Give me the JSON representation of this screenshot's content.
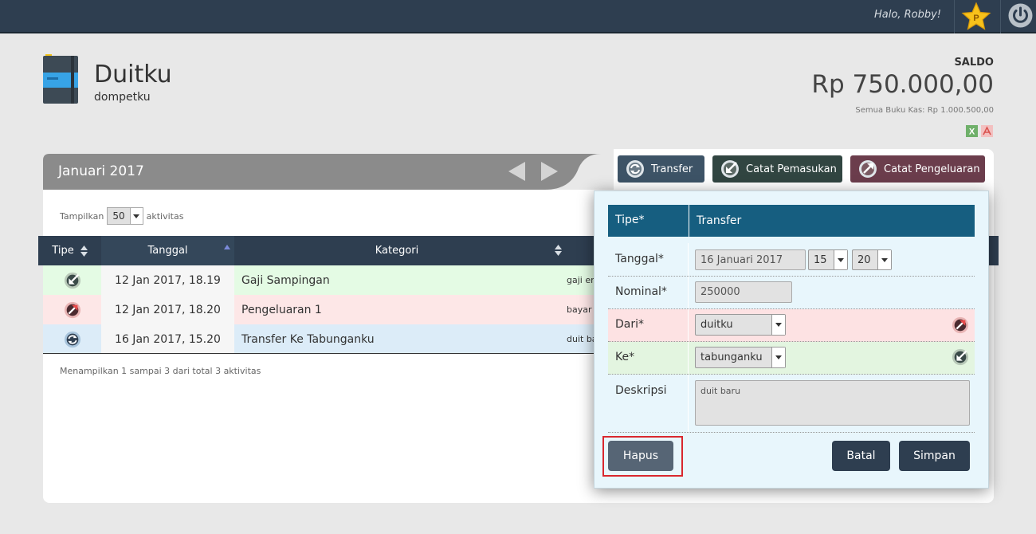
{
  "topbar": {
    "greeting": "Halo, Robby!",
    "star_letter": "P"
  },
  "wallet": {
    "title": "Duitku",
    "subtitle": "dompetku"
  },
  "balance": {
    "label": "SALDO",
    "value": "Rp 750.000,00",
    "all_books": "Semua Buku Kas: Rp 1.000.500,00"
  },
  "period": {
    "month": "Januari 2017"
  },
  "actions": {
    "transfer": "Transfer",
    "income": "Catat Pemasukan",
    "expense": "Catat Pengeluaran"
  },
  "list": {
    "show_prefix": "Tampilkan",
    "page_size": "50",
    "show_suffix": "aktivitas",
    "headers": {
      "type": "Tipe",
      "date": "Tanggal",
      "category": "Kategori"
    },
    "rows": [
      {
        "kind": "income",
        "date": "12 Jan 2017, 18.19",
        "category": "Gaji Sampingan",
        "desc": "gaji en"
      },
      {
        "kind": "expense",
        "date": "12 Jan 2017, 18.20",
        "category": "Pengeluaran 1",
        "desc": "bayar"
      },
      {
        "kind": "transfer",
        "date": "16 Jan 2017, 15.20",
        "category": "Transfer Ke Tabunganku",
        "desc": "duit ba"
      }
    ],
    "footer": "Menampilkan 1 sampai 3 dari total 3 aktivitas"
  },
  "form": {
    "type_label": "Tipe*",
    "type_value": "Transfer",
    "date_label": "Tanggal*",
    "date_value": "16 Januari 2017",
    "hour": "15",
    "minute": "20",
    "amount_label": "Nominal*",
    "amount_value": "250000",
    "from_label": "Dari*",
    "from_value": "duitku",
    "to_label": "Ke*",
    "to_value": "tabunganku",
    "desc_label": "Deskripsi",
    "desc_value": "duit baru",
    "delete_label": "Hapus",
    "cancel_label": "Batal",
    "save_label": "Simpan"
  },
  "colors": {
    "topbar": "#2e3e50",
    "income_row": "#e4fbe4",
    "expense_row": "#fde7e7",
    "transfer_row": "#dcecf8",
    "form_header": "#165e80",
    "transfer_btn": "#3d5366",
    "income_btn": "#314541",
    "expense_btn": "#6b3d4c",
    "highlight": "#d9272e"
  }
}
